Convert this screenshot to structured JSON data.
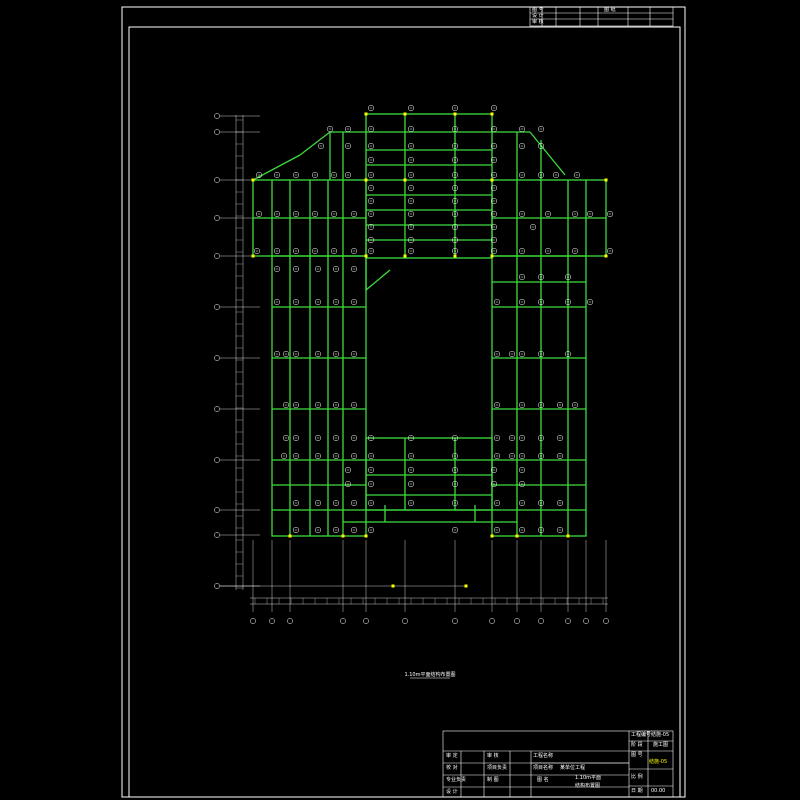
{
  "drawing": {
    "plan_title": "1.10m平面结构布置图",
    "colors": {
      "background": "#000000",
      "border": "#ffffff",
      "beam": "#3cdc3c",
      "grid": "#ffffff",
      "column": "#ffff00",
      "text": "#ffffff"
    }
  },
  "top_block": {
    "rows": [
      [
        "图 号",
        "",
        "",
        "图 纸",
        "",
        ""
      ],
      [
        "设 计",
        "",
        "",
        "",
        "",
        ""
      ],
      [
        "审 核",
        "",
        "",
        "",
        "",
        ""
      ]
    ]
  },
  "title_block": {
    "design_no_label": "工程编号",
    "design_no_value": "结施-05",
    "stage_label": "阶 段",
    "stage_value": "施工图",
    "drawing_no_label": "图 号",
    "drawing_no_value": "结施-05",
    "project_label": "工程名称",
    "project_sub_label": "项目名称",
    "project_value": "",
    "unit_value": "某单位工程",
    "drawing_name_label": "图 名",
    "drawing_name_line1": "1.10m平面",
    "drawing_name_line2": "结构布置图",
    "scale_label": "比 例",
    "date_label": "日 期",
    "date_value": "00.00",
    "left_roles": [
      "审 定",
      "校 对",
      "专业负责",
      "设 计"
    ],
    "mid_roles": [
      "审 核",
      "项目负责",
      "制 图",
      ""
    ]
  }
}
